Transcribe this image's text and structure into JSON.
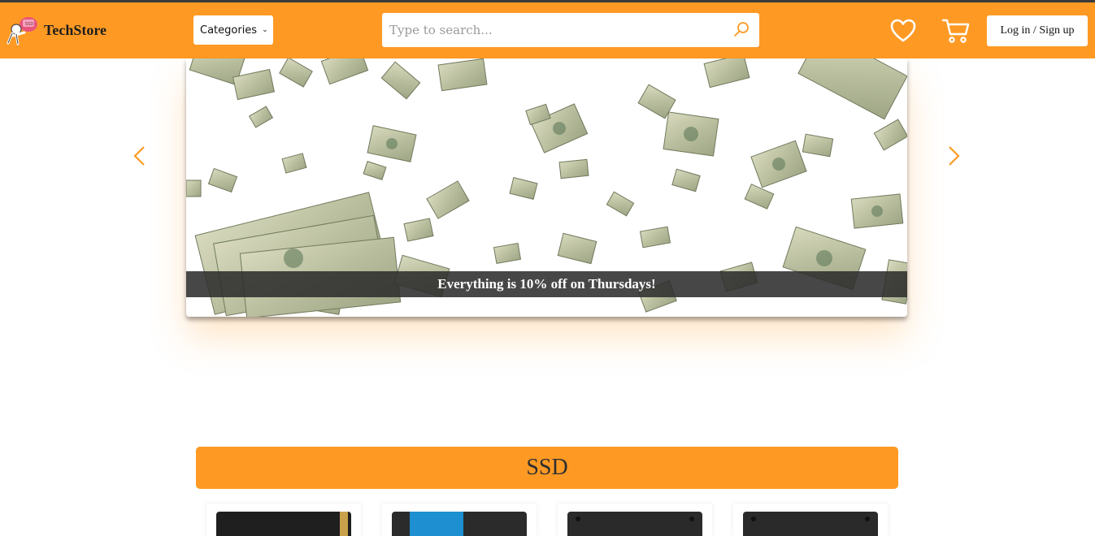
{
  "header": {
    "brand": "TechStore",
    "categories_label": "Categories",
    "search_placeholder": "Type to search...",
    "login_label": "Log in / Sign up",
    "icons": {
      "logo": "mascot-logo-icon",
      "search": "search-icon",
      "wishlist": "heart-icon",
      "cart": "cart-icon",
      "dropdown": "chevron-down-icon"
    }
  },
  "carousel": {
    "caption": "Everything is 10% off on Thursdays!",
    "prev_icon": "chevron-left-icon",
    "next_icon": "chevron-right-icon"
  },
  "sections": [
    {
      "title": "SSD",
      "products": [
        {
          "image": "ssd-product-image"
        },
        {
          "image": "ssd-product-image"
        },
        {
          "image": "ssd-product-image"
        },
        {
          "image": "ssd-product-image"
        }
      ]
    }
  ],
  "colors": {
    "accent": "#fe9a24",
    "header_text": "#1d1d1d",
    "caption_bg": "#2d2d2d"
  }
}
